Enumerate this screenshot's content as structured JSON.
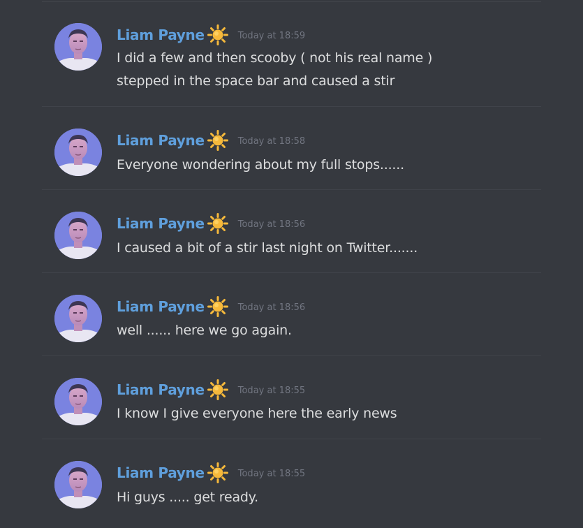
{
  "messages": [
    {
      "author": "Liam Payne",
      "status_emoji": "sun-icon",
      "timestamp": "Today at 18:59",
      "lines": [
        "I did a few and then scooby ( not his real name )",
        "stepped in the space bar and caused a stir"
      ]
    },
    {
      "author": "Liam Payne",
      "status_emoji": "sun-icon",
      "timestamp": "Today at 18:58",
      "lines": [
        "Everyone wondering about my full stops......"
      ]
    },
    {
      "author": "Liam Payne",
      "status_emoji": "sun-icon",
      "timestamp": "Today at 18:56",
      "lines": [
        "I caused a bit of a stir last night on Twitter......."
      ]
    },
    {
      "author": "Liam Payne",
      "status_emoji": "sun-icon",
      "timestamp": "Today at 18:56",
      "lines": [
        "well ...... here we go again."
      ]
    },
    {
      "author": "Liam Payne",
      "status_emoji": "sun-icon",
      "timestamp": "Today at 18:55",
      "lines": [
        "I know I give everyone here the early news"
      ]
    },
    {
      "author": "Liam Payne",
      "status_emoji": "sun-icon",
      "timestamp": "Today at 18:55",
      "lines": [
        "Hi guys ..... get ready."
      ]
    }
  ],
  "colors": {
    "background": "#36393f",
    "username": "#5f9fdc",
    "timestamp": "#717580",
    "message_text": "#dcddde",
    "divider": "#40434a",
    "avatar_bg": "#7a83e0",
    "sun": "#f6b93b"
  }
}
